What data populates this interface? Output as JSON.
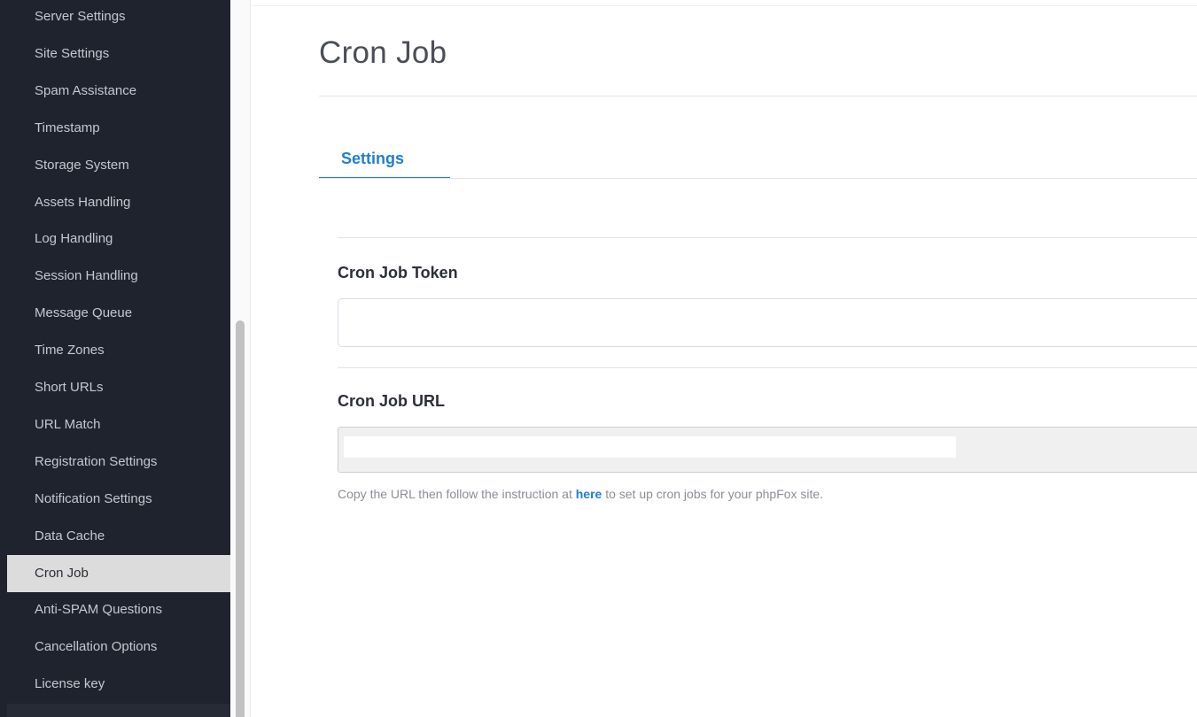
{
  "sidebar": {
    "items": [
      {
        "label": "Server Settings",
        "active": false
      },
      {
        "label": "Site Settings",
        "active": false
      },
      {
        "label": "Spam Assistance",
        "active": false
      },
      {
        "label": "Timestamp",
        "active": false
      },
      {
        "label": "Storage System",
        "active": false
      },
      {
        "label": "Assets Handling",
        "active": false
      },
      {
        "label": "Log Handling",
        "active": false
      },
      {
        "label": "Session Handling",
        "active": false
      },
      {
        "label": "Message Queue",
        "active": false
      },
      {
        "label": "Time Zones",
        "active": false
      },
      {
        "label": "Short URLs",
        "active": false
      },
      {
        "label": "URL Match",
        "active": false
      },
      {
        "label": "Registration Settings",
        "active": false
      },
      {
        "label": "Notification Settings",
        "active": false
      },
      {
        "label": "Data Cache",
        "active": false
      },
      {
        "label": "Cron Job",
        "active": true
      },
      {
        "label": "Anti-SPAM Questions",
        "active": false
      },
      {
        "label": "Cancellation Options",
        "active": false
      },
      {
        "label": "License key",
        "active": false
      }
    ]
  },
  "main": {
    "title": "Cron Job",
    "tabs": [
      {
        "label": "Settings",
        "active": true
      }
    ],
    "fields": {
      "token": {
        "label": "Cron Job Token",
        "value": "",
        "placeholder": ""
      },
      "url": {
        "label": "Cron Job URL",
        "value": "",
        "placeholder": ""
      }
    },
    "help": {
      "prefix": "Copy the URL then follow the instruction at ",
      "link_text": "here",
      "suffix": " to set up cron jobs for your phpFox site."
    }
  },
  "colors": {
    "sidebar_bg": "#1f232d",
    "active_item_bg": "#dcdcdc",
    "accent": "#1f7ed6"
  }
}
